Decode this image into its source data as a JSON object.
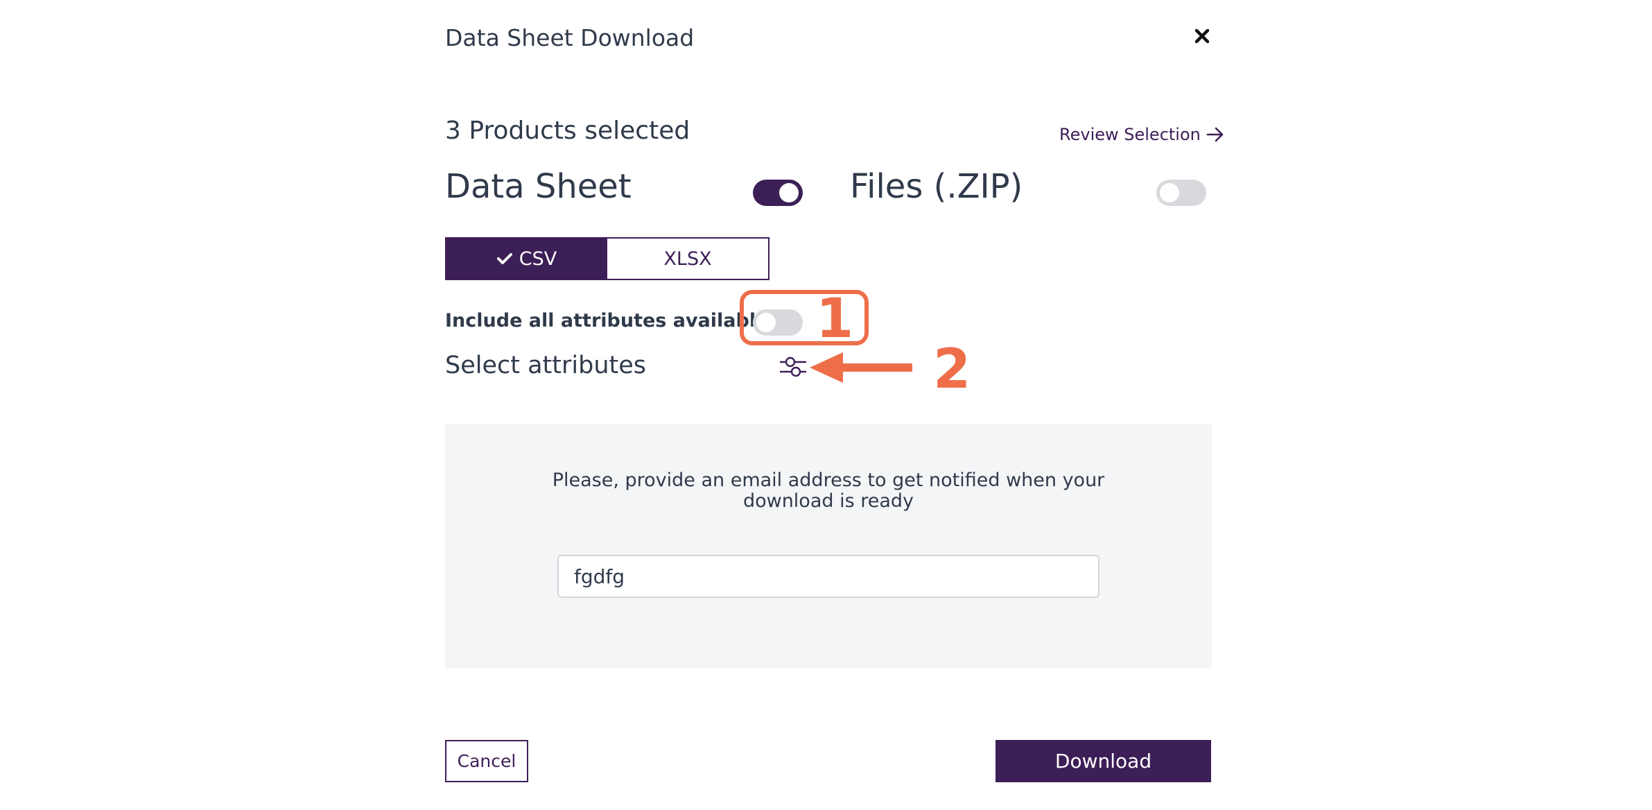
{
  "dialog": {
    "title": "Data Sheet Download",
    "close_icon": "close-icon"
  },
  "selection": {
    "summary": "3 Products selected",
    "review_label": "Review Selection",
    "review_icon": "arrow-right-icon"
  },
  "data_sheet": {
    "label": "Data Sheet",
    "enabled": true
  },
  "files_zip": {
    "label": "Files (.ZIP)",
    "enabled": false
  },
  "format": {
    "options": [
      {
        "label": "CSV",
        "selected": true,
        "icon": "check-icon"
      },
      {
        "label": "XLSX",
        "selected": false
      }
    ]
  },
  "attributes": {
    "include_all_label": "Include all attributes available",
    "include_all_enabled": false,
    "select_label": "Select attributes",
    "select_icon": "sliders-icon"
  },
  "annotations": {
    "marker_1": "1",
    "marker_2": "2",
    "color": "#ee6e49"
  },
  "email": {
    "message_line1": "Please, provide an email address to get notified when your",
    "message_line2": "download is ready",
    "value": "fgdfg"
  },
  "actions": {
    "cancel_label": "Cancel",
    "download_label": "Download"
  },
  "colors": {
    "primary": "#3d1f57",
    "text": "#2f3a4a",
    "panel_bg": "#f4f5f7",
    "toggle_off": "#d7d9dd"
  }
}
